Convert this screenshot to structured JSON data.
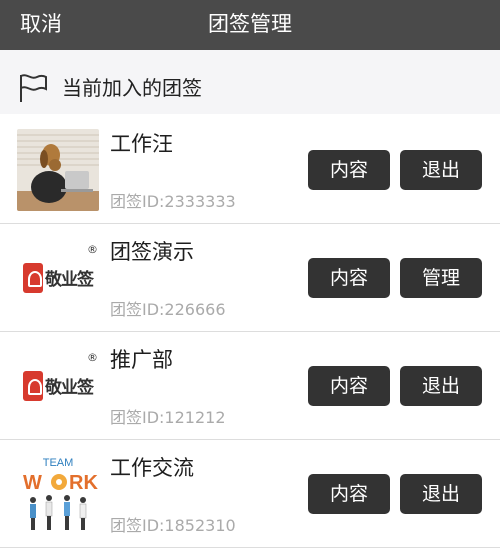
{
  "topbar": {
    "cancel_label": "取消",
    "title": "团签管理"
  },
  "section": {
    "label": "当前加入的团签"
  },
  "groups": [
    {
      "name": "工作汪",
      "id_text": "团签ID:2333333",
      "btn1": "内容",
      "btn2": "退出",
      "thumb": "dog-photo"
    },
    {
      "name": "团签演示",
      "id_text": "团签ID:226666",
      "btn1": "内容",
      "btn2": "管理",
      "thumb": "jingyeqian-logo"
    },
    {
      "name": "推广部",
      "id_text": "团签ID:121212",
      "btn1": "内容",
      "btn2": "退出",
      "thumb": "jingyeqian-logo"
    },
    {
      "name": "工作交流",
      "id_text": "团签ID:1852310",
      "btn1": "内容",
      "btn2": "退出",
      "thumb": "team-work-image"
    }
  ],
  "logo": {
    "brand_text": "敬业签",
    "reg_mark": "®"
  },
  "teamwork": {
    "top": "TEAM",
    "bottom_left": "W",
    "bottom_o": "O",
    "bottom_right": "RK"
  },
  "colors": {
    "topbar": "#4a4a4a",
    "button": "#333333",
    "brand_red": "#d73a2e"
  }
}
